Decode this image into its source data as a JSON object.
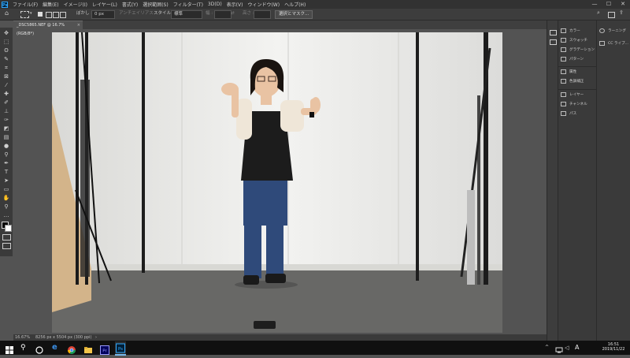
{
  "menubar": {
    "app_logo": "Ps",
    "items": [
      "ファイル(F)",
      "編集(E)",
      "イメージ(I)",
      "レイヤー(L)",
      "書式(Y)",
      "選択範囲(S)",
      "フィルター(T)",
      "3D(D)",
      "表示(V)",
      "ウィンドウ(W)",
      "ヘルプ(H)"
    ],
    "window_controls": [
      "—",
      "☐",
      "✕"
    ]
  },
  "options": {
    "feather_label": "ぼかし :",
    "feather_value": "0 px",
    "antialias_label": "アンチエイリアス",
    "style_label": "スタイル :",
    "style_value": "標準",
    "width_label": "幅 :",
    "height_label": "高さ :",
    "select_mask_button": "選択とマスク..."
  },
  "document": {
    "tab_title": "_DSC5865.NEF @ 16.7% (RGB/8*)",
    "close_glyph": "×"
  },
  "status": {
    "zoom": "16.67%",
    "doc_info": "8256 px x 5504 px (300 ppi)",
    "arrow": "›"
  },
  "panels": {
    "group1": [
      "カラー",
      "スウォッチ",
      "グラデーション",
      "パターン"
    ],
    "group2": [
      "属性",
      "色調補正"
    ],
    "group3": [
      "レイヤー",
      "チャンネル",
      "パス"
    ],
    "right_group": [
      "ラーニング",
      "CC ライブ..."
    ]
  },
  "tray": {
    "ime": "A",
    "time": "16:51",
    "date": "2019/11/22"
  },
  "colors": {
    "accent": "#31a8ff",
    "menu_bg": "#323232",
    "workspace": "#535353"
  }
}
